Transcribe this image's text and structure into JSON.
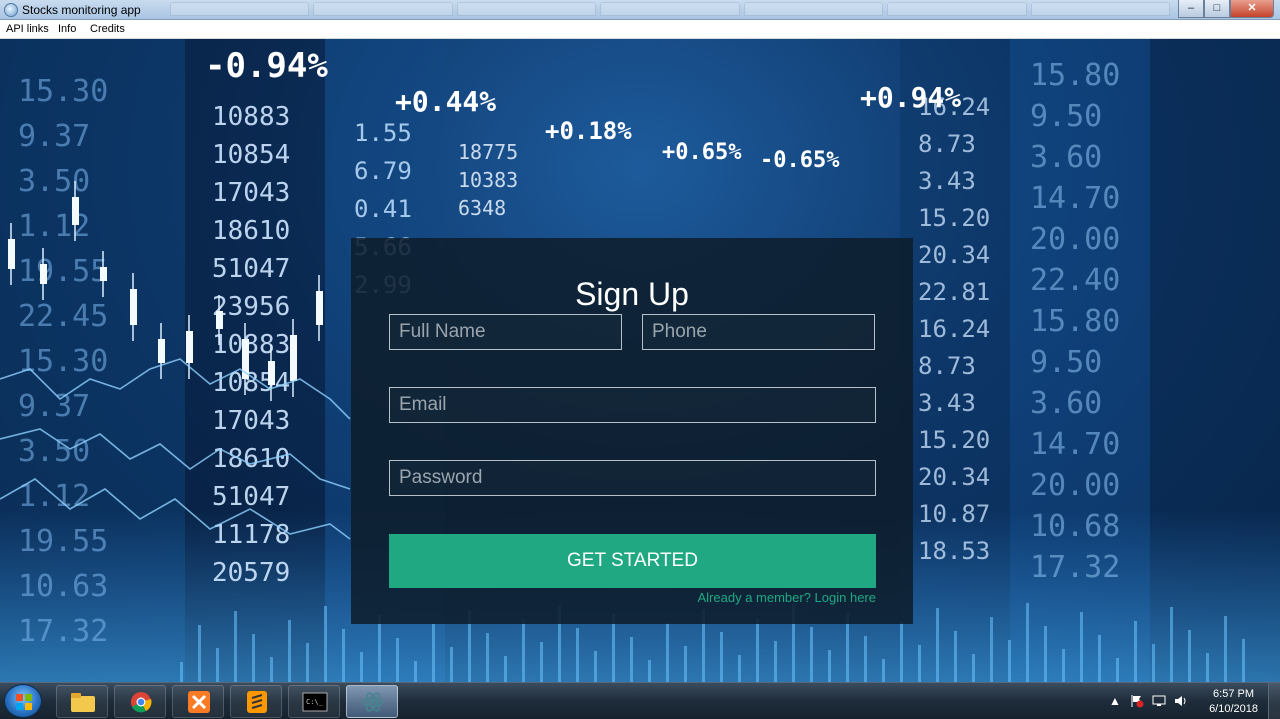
{
  "window": {
    "title": "Stocks monitoring app"
  },
  "window_controls": {
    "minimize": "–",
    "maximize": "□",
    "close": "✕"
  },
  "menu": {
    "items": [
      "API links",
      "Info",
      "Credits"
    ]
  },
  "background": {
    "tickers_left": [
      "15.30",
      "9.37",
      "3.50",
      "1.12",
      "19.55",
      "22.45",
      "15.30",
      "9.37",
      "3.50",
      "1.12",
      "19.55",
      "10.63",
      "17.32"
    ],
    "tickers_mid": [
      "10883",
      "10854",
      "17043",
      "18610",
      "51047",
      "23956",
      "10883",
      "10854",
      "17043",
      "18610",
      "51047",
      "11178",
      "20579"
    ],
    "tickers_mid2": [
      "1.55",
      "6.79",
      "0.41",
      "5.66",
      "2.99"
    ],
    "tickers_mid3": [
      "18775",
      "10383",
      "6348"
    ],
    "tickers_right": [
      "16.24",
      "8.73",
      "3.43",
      "15.20",
      "20.34",
      "22.81",
      "16.24",
      "8.73",
      "3.43",
      "15.20",
      "20.34",
      "10.87",
      "18.53"
    ],
    "tickers_far_right": [
      "15.80",
      "9.50",
      "3.60",
      "14.70",
      "20.00",
      "22.40",
      "15.80",
      "9.50",
      "3.60",
      "14.70",
      "20.00",
      "10.68",
      "17.32"
    ],
    "percent_labels": [
      "-0.94%",
      "+0.44%",
      "+0.18%",
      "+0.65%",
      "-0.65%",
      "+0.94%"
    ]
  },
  "signup": {
    "title": "Sign Up",
    "full_name_placeholder": "Full Name",
    "phone_placeholder": "Phone",
    "email_placeholder": "Email",
    "password_placeholder": "Password",
    "submit_label": "GET STARTED",
    "login_link": "Already a member? Login here"
  },
  "colors": {
    "accent": "#20a883",
    "card": "#0e1e2c"
  },
  "taskbar": {
    "apps": [
      {
        "name": "windows-explorer",
        "icon": "folder-icon"
      },
      {
        "name": "chrome",
        "icon": "chrome-icon"
      },
      {
        "name": "xampp",
        "icon": "xampp-icon"
      },
      {
        "name": "sublime-text",
        "icon": "sublime-icon"
      },
      {
        "name": "command-prompt",
        "icon": "terminal-icon"
      },
      {
        "name": "electron-app",
        "icon": "electron-icon"
      }
    ],
    "time": "6:57 PM",
    "date": "6/10/2018"
  }
}
